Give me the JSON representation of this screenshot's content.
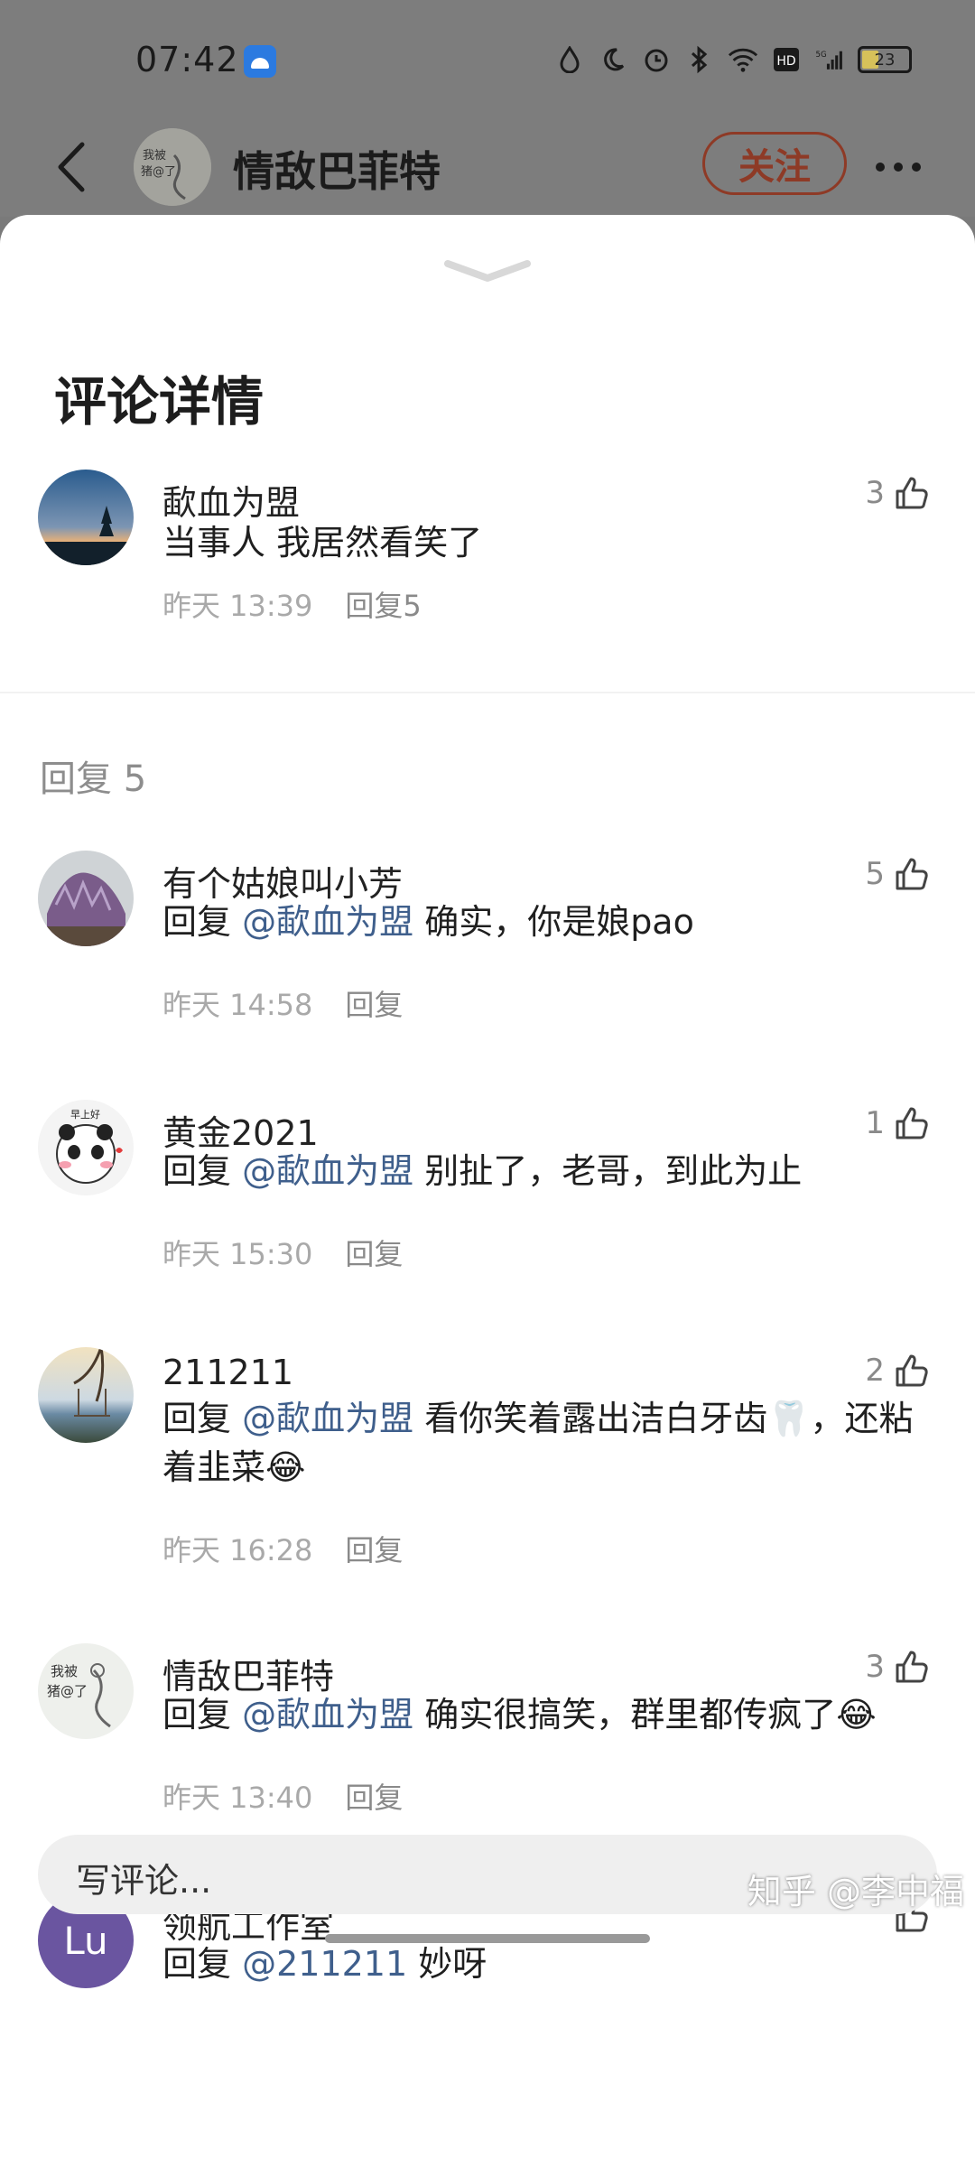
{
  "status_bar": {
    "time": "07:42",
    "battery": "23",
    "icons": [
      "water-drop-icon",
      "moon-icon",
      "alarm-icon",
      "bluetooth-icon",
      "wifi-icon",
      "hd-icon",
      "5g-signal-icon",
      "battery-icon"
    ]
  },
  "header": {
    "title": "情敌巴菲特",
    "follow_label": "关注"
  },
  "sheet": {
    "title": "评论详情",
    "main_comment": {
      "name": "歃血为盟",
      "text": "当事人 我居然看笑了",
      "time": "昨天 13:39",
      "reply_label": "回复5",
      "likes": "3"
    },
    "replies_header": "回复 5",
    "replies": [
      {
        "name": "有个姑娘叫小芳",
        "prefix": "回复 ",
        "mention": "@歃血为盟",
        "text": " 确实，你是娘pao",
        "time": "昨天 14:58",
        "reply_label": "回复",
        "likes": "5"
      },
      {
        "name": "黄金2021",
        "prefix": "回复 ",
        "mention": "@歃血为盟",
        "text": " 别扯了，老哥，到此为止",
        "time": "昨天 15:30",
        "reply_label": "回复",
        "likes": "1"
      },
      {
        "name": "211211",
        "prefix": "回复 ",
        "mention": "@歃血为盟",
        "text": " 看你笑着露出洁白牙齿🦷，还粘着韭菜😂",
        "time": "昨天 16:28",
        "reply_label": "回复",
        "likes": "2"
      },
      {
        "name": "情敌巴菲特",
        "prefix": "回复 ",
        "mention": "@歃血为盟",
        "text": " 确实很搞笑，群里都传疯了😂",
        "time": "昨天 13:40",
        "reply_label": "回复",
        "likes": "3"
      },
      {
        "name": "领航工作室",
        "prefix": "回复 ",
        "mention": "@211211",
        "text": " 妙呀",
        "avatar_text": "Lu",
        "likes": ""
      }
    ]
  },
  "input": {
    "placeholder": "写评论..."
  },
  "watermark": "知乎 @李中福",
  "colors": {
    "mention": "#3f5f8c",
    "follow": "#8e3a26",
    "avatar_lu": "#6a55a0"
  }
}
